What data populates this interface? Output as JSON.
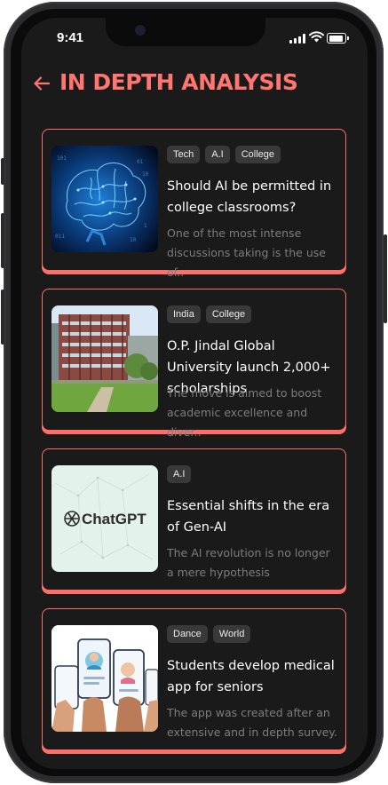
{
  "status_bar": {
    "time": "9:41"
  },
  "header": {
    "title": "IN DEPTH ANALYSIS",
    "back_icon": "arrow-left-icon"
  },
  "colors": {
    "accent": "#ff6f6a",
    "background": "#1b1a1a",
    "tag_bg": "#3a3939",
    "muted": "#7e7c7c"
  },
  "articles": [
    {
      "tags": [
        "Tech",
        "A.I",
        "College"
      ],
      "headline": "Should AI be permitted in college classrooms?",
      "snippet": "One of the most intense discussions taking is the use of..",
      "image": "digital-brain"
    },
    {
      "tags": [
        "India",
        "College"
      ],
      "headline": "O.P. Jindal Global University launch 2,000+ scholarships",
      "snippet": "The move is aimed to boost academic excellence and diver..",
      "image": "university-building"
    },
    {
      "tags": [
        "A.I"
      ],
      "headline": "Essential shifts in the era of Gen-AI",
      "snippet": "The AI revolution is no longer a mere hypothesis",
      "image": "chatgpt-logo",
      "image_text": "ChatGPT"
    },
    {
      "tags": [
        "Dance",
        "World"
      ],
      "headline": "Students develop medical app for seniors",
      "snippet": "The app was created after an extensive and in depth survey.",
      "image": "hands-with-phones"
    }
  ]
}
